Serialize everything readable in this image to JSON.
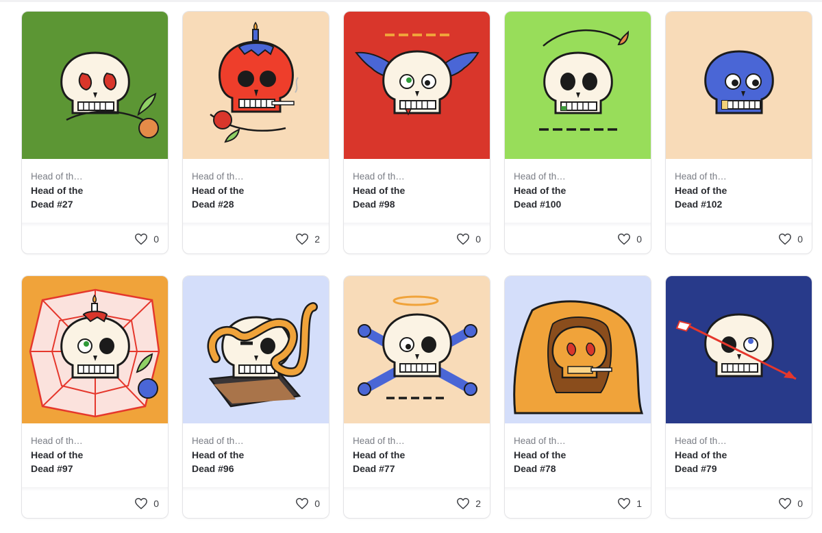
{
  "cards": [
    {
      "collection": "Head of th…",
      "name": "Head of the Dead #27",
      "likes": "0",
      "bg": "#5c9634"
    },
    {
      "collection": "Head of th…",
      "name": "Head of the Dead #28",
      "likes": "2",
      "bg": "#f8dbb8"
    },
    {
      "collection": "Head of th…",
      "name": "Head of the Dead #98",
      "likes": "0",
      "bg": "#d9362b"
    },
    {
      "collection": "Head of th…",
      "name": "Head of the Dead #100",
      "likes": "0",
      "bg": "#98dd5a"
    },
    {
      "collection": "Head of th…",
      "name": "Head of the Dead #102",
      "likes": "0",
      "bg": "#f8dbb8"
    },
    {
      "collection": "Head of th…",
      "name": "Head of the Dead #97",
      "likes": "0",
      "bg": "#f0a33a"
    },
    {
      "collection": "Head of th…",
      "name": "Head of the Dead #96",
      "likes": "0",
      "bg": "#d4defa"
    },
    {
      "collection": "Head of th…",
      "name": "Head of the Dead #77",
      "likes": "2",
      "bg": "#f8dbb8"
    },
    {
      "collection": "Head of th…",
      "name": "Head of the Dead #78",
      "likes": "1",
      "bg": "#d4defa"
    },
    {
      "collection": "Head of th…",
      "name": "Head of the Dead #79",
      "likes": "0",
      "bg": "#283a8a"
    }
  ],
  "icons": {
    "like": "heart-icon"
  }
}
